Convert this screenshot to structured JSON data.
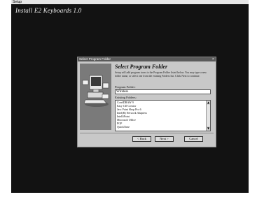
{
  "window": {
    "title": "Setup"
  },
  "installer": {
    "heading": "Install E2 Keyboards 1.0"
  },
  "dialog": {
    "title": "Select Program Folder",
    "close_glyph": "×",
    "step_title": "Select Program Folder",
    "description": "Setup will add program icons to the Program Folder listed below. You may type a new folder name, or select one from the existing Folders list. Click Next to continue.",
    "program_folder_label": "Program Folder:",
    "program_folder_value": "Wireless",
    "existing_folders_label": "Existing Folders:",
    "existing_folders": [
      "CorelDRAW 9",
      "Easy CD Creator",
      "Jasc Paint Shop Pro 6",
      "Intel(R) Network Adapters",
      "IntelliPoint",
      "Microsoft Office",
      "PGP",
      "QuickTime"
    ],
    "buttons": {
      "back": "< Back",
      "next": "Next >",
      "cancel": "Cancel"
    }
  },
  "icons": {
    "scroll_up": "▲",
    "scroll_down": "▼"
  }
}
